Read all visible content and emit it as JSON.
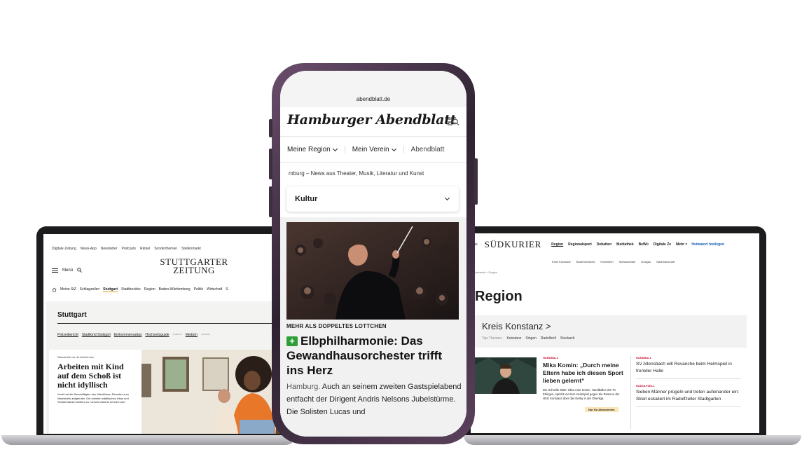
{
  "stuttgarter": {
    "top_links": [
      "Digitale Zeitung",
      "News-App",
      "Newsletter",
      "Podcasts",
      "Rätsel",
      "Sonderthemen",
      "Stellenmarkt"
    ],
    "menu_label": "Menü",
    "logo_line1": "STUTTGARTER",
    "logo_line2": "ZEITUNG",
    "main_nav": [
      "Meine StZ",
      "Schlagzeilen",
      "Stuttgart",
      "Stadtbezirke",
      "Region",
      "Baden-Württemberg",
      "Politik",
      "Wirtschaft",
      "S"
    ],
    "active_nav": "Stuttgart",
    "section_title": "Stuttgart",
    "sub_nav": [
      {
        "label": "Polizeibericht",
        "badge": ""
      },
      {
        "label": "Stadtkind Stuttgart",
        "badge": ""
      },
      {
        "label": "Einkommensatlas",
        "badge": ""
      },
      {
        "label": "Hochzeitsguide",
        "badge": "ANZEIGE"
      },
      {
        "label": "Medizin",
        "badge": "ANZEIGE"
      }
    ],
    "article": {
      "kicker": "Warnstreik von Erzieherinnen",
      "headline": "Arbeiten mit Kind auf dem Schoß ist nicht idyllisch",
      "teaser": "Verdi hat die Beschäftigten des öffentlichen Dienstes zum Warnstreik aufgerufen. Die meisten städtischen Kitas und Schülerhäuser bleiben zu. Unsere Autorin erinnert sich"
    }
  },
  "phone": {
    "url": "abendblatt.de",
    "logo": "Hamburger Abendblatt",
    "nav": [
      {
        "label": "Meine Region",
        "has_chevron": true
      },
      {
        "label": "Mein Verein",
        "has_chevron": true
      },
      {
        "label": "Abendblatt",
        "has_chevron": false
      }
    ],
    "tagline": "mburg – News aus Theater, Musik, Literatur und Kunst",
    "dropdown_label": "Kultur",
    "article": {
      "kicker": "MEHR ALS DOPPELTES LOTTCHEN",
      "plus_badge": "+",
      "headline": "Elbphilharmonie: Das Gewandhausorchester trifft ins Herz",
      "location": "Hamburg.",
      "body": " Auch an seinem zweiten Gastspielabend entfacht der Dirigent Andris Nelsons Jubelstürme. Die Solisten Lucas und"
    }
  },
  "suedkurier": {
    "menu_label": "nü",
    "logo": "SÜDKURIER",
    "nav": [
      "Region",
      "Regionalsport",
      "Debatten",
      "Mediathek",
      "BeWü",
      "Digitale Ze",
      "Mehr >"
    ],
    "active_nav": "Region",
    "cta": "Heimatort festlegen",
    "sub_nav": [
      "Kreis Konstanz",
      "Bodenseekreis",
      "Hochrhein",
      "Schwarzwald",
      "Linzgau",
      "Nachbarschaft"
    ],
    "breadcrumb": "Startseite  >  Region",
    "page_title": "Region",
    "box_title": "Kreis Konstanz >",
    "box_label": "Top-Themen:",
    "box_topics": [
      "Konstanz",
      "Singen",
      "Radolfzell",
      "Stockach"
    ],
    "main_article": {
      "tag": "HANDBALL",
      "headline": "Mika Komin: „Durch meine Eltern habe ich diesen Sport lieben gelernt“",
      "body": "Die Schnelle Mitte: Mika Ante Komin, Handballer des TV Ehingen, spricht vor dem Heimspiel gegen die Reserve der HSG Konstanz über das Derby in der Oberliga.",
      "badge": "Nur für Abonnenten"
    },
    "side_articles": [
      {
        "tag": "HANDBALL",
        "headline": "SV Allensbach will Revanche beim Heimspiel in fremder Halle"
      },
      {
        "tag": "RADOLFZELL",
        "headline": "Sieben Männer prügeln und treten aufeinander ein: Streit eskaliert im Radolfzeller Stadtgarten"
      }
    ]
  },
  "colors": {
    "green_plus": "#2d9e38",
    "sk_red": "#c8102e",
    "sk_blue": "#1a5fb4",
    "stz_gold": "#d4a10b",
    "phone_frame": "#4b344c"
  }
}
